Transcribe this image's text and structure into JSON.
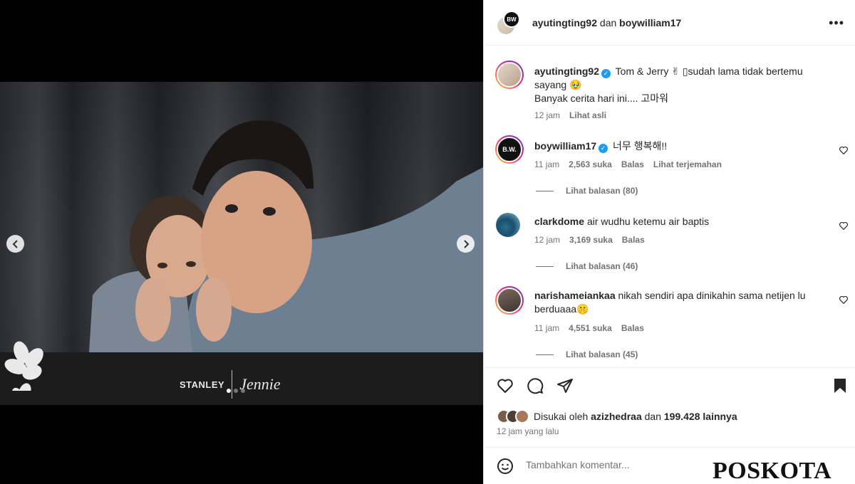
{
  "header": {
    "user1": "ayutingting92",
    "joiner": "dan",
    "user2": "boywilliam17",
    "avatar2_text": "BW"
  },
  "media": {
    "brand_left": "STANLEY",
    "brand_right": "Jennie",
    "slide_count": 3,
    "active_slide": 1
  },
  "caption": {
    "username": "ayutingting92",
    "line1": "Tom & Jerry ✌ ▯sudah lama tidak bertemu sayang 🥹",
    "line2": "Banyak cerita hari ini.... 고마워",
    "time": "12 jam",
    "see_original": "Lihat asli"
  },
  "comments": [
    {
      "username": "boywilliam17",
      "verified": true,
      "avatar_text": "B.W.",
      "text": "너무 행복해!!",
      "time": "11 jam",
      "likes": "2,563 suka",
      "reply": "Balas",
      "translate": "Lihat terjemahan",
      "view_replies": "Lihat balasan (80)"
    },
    {
      "username": "clarkdome",
      "verified": false,
      "text": "air wudhu ketemu air baptis",
      "time": "12 jam",
      "likes": "3,169 suka",
      "reply": "Balas",
      "view_replies": "Lihat balasan (46)"
    },
    {
      "username": "narishameiankaa",
      "verified": false,
      "text": "nikah sendiri apa dinikahin sama netijen lu berduaaa🤫",
      "time": "11 jam",
      "likes": "4,551 suka",
      "reply": "Balas",
      "view_replies": "Lihat balasan (45)"
    }
  ],
  "likes": {
    "prefix": "Disukai oleh",
    "user": "azizhedraa",
    "middle": "dan",
    "count": "199.428 lainnya"
  },
  "post_time": "12 jam yang lalu",
  "comment_box": {
    "placeholder": "Tambahkan komentar..."
  },
  "watermark": "POSKOTA",
  "icons": [
    "chevron-left-icon",
    "chevron-right-icon",
    "more-icon",
    "verified-icon",
    "heart-icon",
    "comment-icon",
    "share-icon",
    "bookmark-icon",
    "emoji-icon"
  ]
}
